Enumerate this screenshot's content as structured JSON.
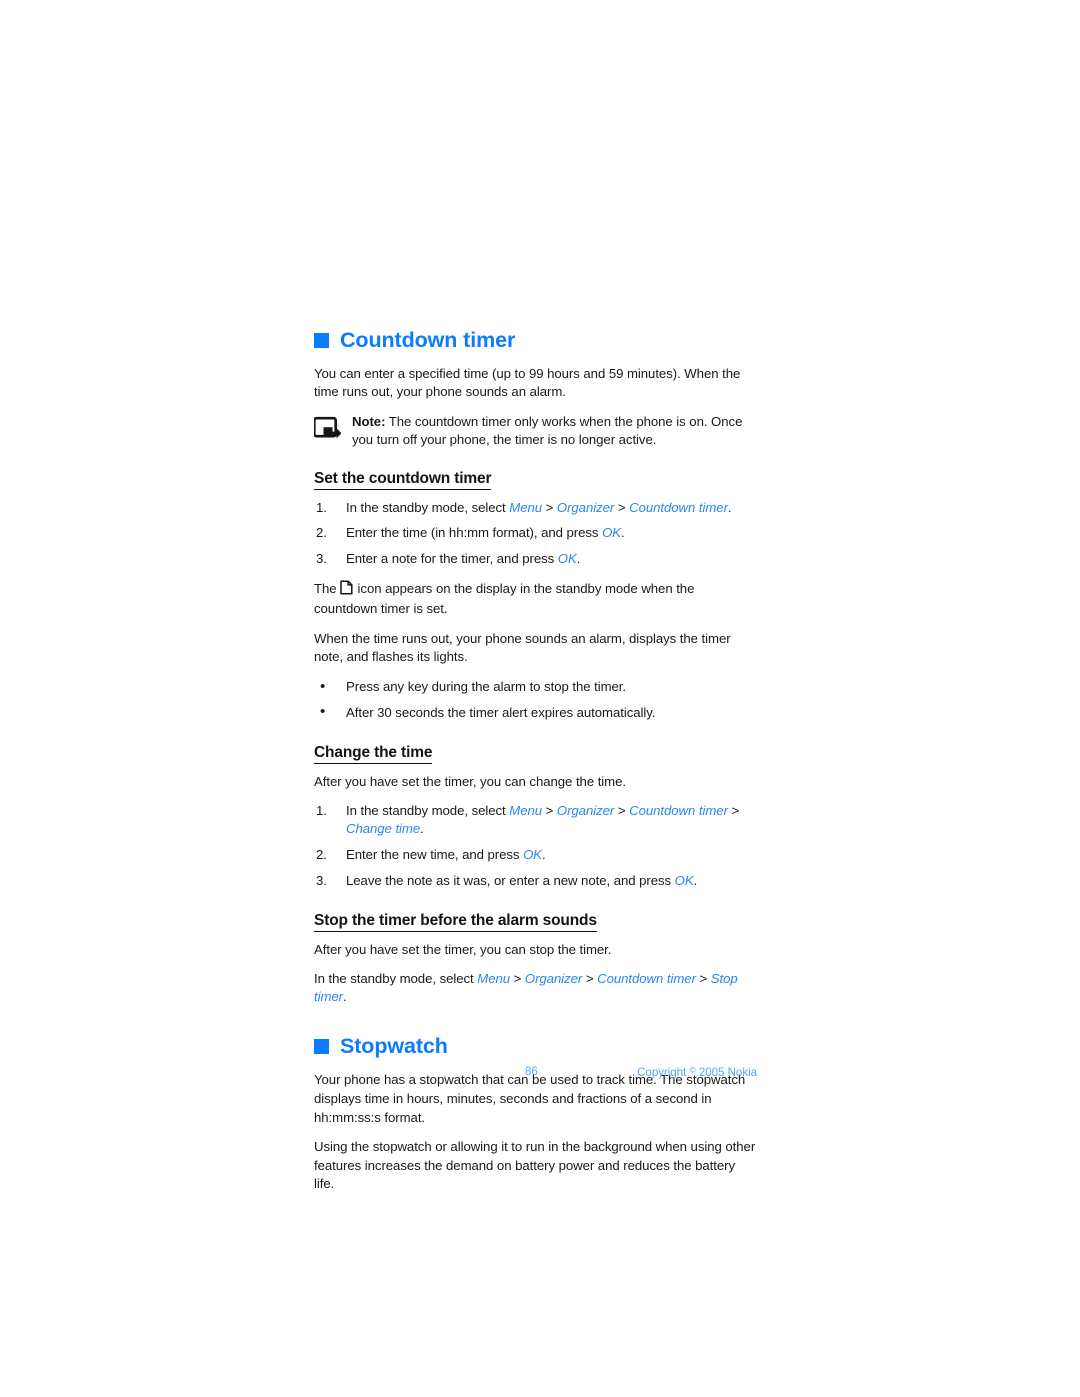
{
  "document": {
    "page_number": "86",
    "copyright_prefix": "Copyright",
    "copyright_symbol": "©",
    "copyright_suffix": "2005 Nokia"
  },
  "colors": {
    "heading_blue": "#0a7cff",
    "link_blue": "#2b86f0",
    "footer_blue": "#5aa6f5",
    "body_text": "#1a1a1a"
  },
  "sections": {
    "countdown": {
      "title": "Countdown timer",
      "intro": "You can enter a specified time (up to 99 hours and 59 minutes). When the time runs out, your phone sounds an alarm.",
      "note": {
        "label": "Note:",
        "text": " The countdown timer only works when the phone is on. Once you turn off your phone, the timer is no longer active."
      },
      "set": {
        "heading": "Set the countdown timer",
        "steps": [
          {
            "num": "1.",
            "before": "In the standby mode, select ",
            "path": [
              "Menu",
              "Organizer",
              "Countdown timer"
            ],
            "after": "."
          },
          {
            "num": "2.",
            "before": "Enter the time (in hh:mm format), and press ",
            "path": [
              "OK"
            ],
            "after": "."
          },
          {
            "num": "3.",
            "before": "Enter a note for the timer, and press ",
            "path": [
              "OK"
            ],
            "after": "."
          }
        ],
        "icon_para_before": "The",
        "icon_name": "countdown-timer-display-icon",
        "icon_para_after": "icon appears on the display in the standby mode when the countdown timer is set.",
        "alarm_para": "When the time runs out, your phone sounds an alarm, displays the timer note, and flashes its lights.",
        "bullets": [
          "Press any key during the alarm to stop the timer.",
          "After 30 seconds the timer alert expires automatically."
        ]
      },
      "change": {
        "heading": "Change the time",
        "intro": "After you have set the timer, you can change the time.",
        "steps": [
          {
            "num": "1.",
            "before": "In the standby mode, select ",
            "path": [
              "Menu",
              "Organizer",
              "Countdown timer",
              "Change time"
            ],
            "after": "."
          },
          {
            "num": "2.",
            "before": "Enter the new time, and press ",
            "path": [
              "OK"
            ],
            "after": "."
          },
          {
            "num": "3.",
            "before": "Leave the note as it was, or enter a new note, and press ",
            "path": [
              "OK"
            ],
            "after": "."
          }
        ]
      },
      "stop": {
        "heading": "Stop the timer before the alarm sounds",
        "intro": "After you have set the timer, you can stop the timer.",
        "path_line": {
          "before": "In the standby mode, select ",
          "path": [
            "Menu",
            "Organizer",
            "Countdown timer",
            "Stop timer"
          ],
          "after": "."
        }
      }
    },
    "stopwatch": {
      "title": "Stopwatch",
      "paragraphs": [
        "Your phone has a stopwatch that can be used to track time. The stopwatch displays time in hours, minutes, seconds and fractions of a second in hh:mm:ss:s format.",
        "Using the stopwatch or allowing it to run in the background when using other features increases the demand on battery power and reduces the battery life."
      ]
    }
  }
}
